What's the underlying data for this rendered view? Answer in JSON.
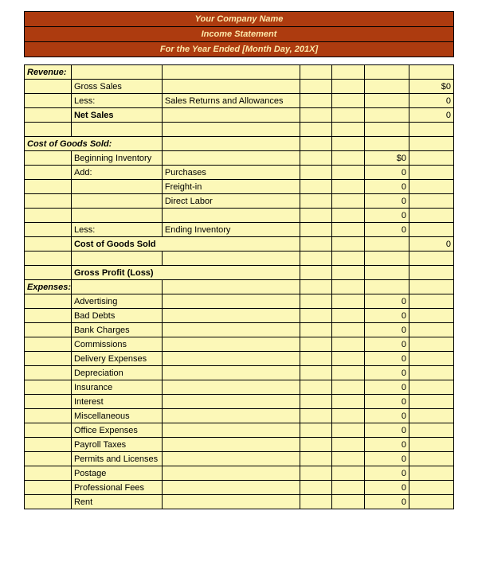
{
  "header": {
    "company": "Your Company Name",
    "title": "Income Statement",
    "period": "For the Year Ended [Month Day, 201X]"
  },
  "sections": {
    "revenue": {
      "label": "Revenue:",
      "gross_sales": {
        "label": "Gross Sales",
        "value": "$0"
      },
      "less": {
        "label": "Less:",
        "sub": "Sales Returns and Allowances",
        "value": "0"
      },
      "net_sales": {
        "label": "Net Sales",
        "value": "0"
      }
    },
    "cogs": {
      "label": "Cost of Goods Sold:",
      "beginning_inventory": {
        "label": "Beginning Inventory",
        "value": "$0"
      },
      "add": {
        "label": "Add:"
      },
      "purchases": {
        "label": "Purchases",
        "value": "0"
      },
      "freight_in": {
        "label": "Freight-in",
        "value": "0"
      },
      "direct_labor": {
        "label": "Direct Labor",
        "value": "0"
      },
      "subtotal": {
        "value": "0"
      },
      "less": {
        "label": "Less:",
        "sub": "Ending Inventory",
        "value": "0"
      },
      "total": {
        "label": "Cost of Goods Sold",
        "value": "0"
      },
      "gross_profit": {
        "label": "Gross Profit (Loss)"
      }
    },
    "expenses": {
      "label": "Expenses:",
      "items": [
        {
          "label": "Advertising",
          "value": "0"
        },
        {
          "label": "Bad Debts",
          "value": "0"
        },
        {
          "label": "Bank Charges",
          "value": "0"
        },
        {
          "label": "Commissions",
          "value": "0"
        },
        {
          "label": "Delivery Expenses",
          "value": "0"
        },
        {
          "label": "Depreciation",
          "value": "0"
        },
        {
          "label": "Insurance",
          "value": "0"
        },
        {
          "label": "Interest",
          "value": "0"
        },
        {
          "label": "Miscellaneous",
          "value": "0"
        },
        {
          "label": "Office Expenses",
          "value": "0"
        },
        {
          "label": "Payroll Taxes",
          "value": "0"
        },
        {
          "label": "Permits and Licenses",
          "value": "0"
        },
        {
          "label": "Postage",
          "value": "0"
        },
        {
          "label": "Professional Fees",
          "value": "0"
        },
        {
          "label": "Rent",
          "value": "0"
        }
      ]
    }
  }
}
